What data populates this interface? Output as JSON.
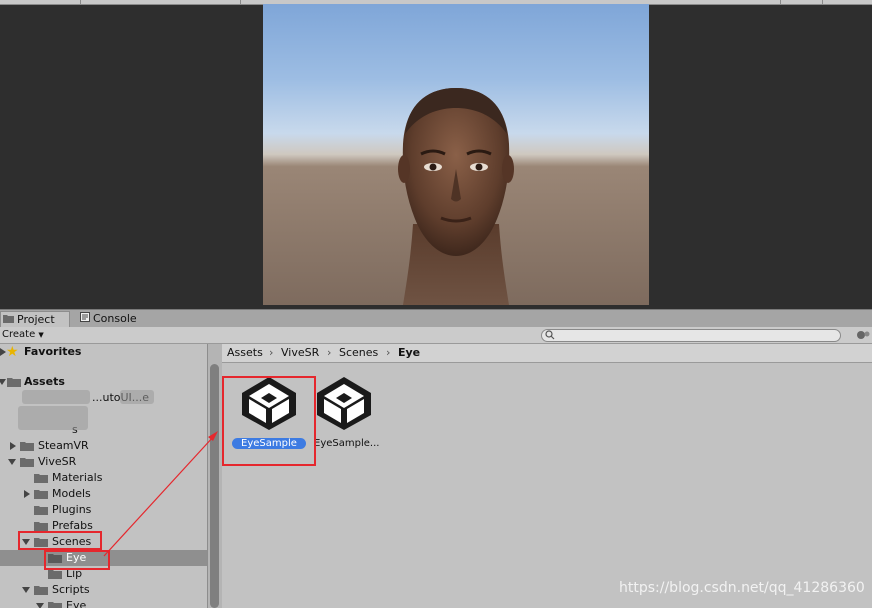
{
  "tabs": [
    {
      "label": "Project",
      "icon": "folder-icon",
      "active": true
    },
    {
      "label": "Console",
      "icon": "console-icon",
      "active": false
    }
  ],
  "toolbar": {
    "create_label": "Create",
    "filter_icon": "filter-icon"
  },
  "tree": {
    "favorites_label": "Favorites",
    "assets_label": "Assets",
    "items": [
      {
        "label": "...utoUI...e"
      },
      {
        "label": "s"
      },
      {
        "label": "SteamVR"
      },
      {
        "label": "ViveSR"
      },
      {
        "label": "Materials"
      },
      {
        "label": "Models"
      },
      {
        "label": "Plugins"
      },
      {
        "label": "Prefabs"
      },
      {
        "label": "Scenes"
      },
      {
        "label": "Eye"
      },
      {
        "label": "Lip"
      },
      {
        "label": "Scripts"
      },
      {
        "label": "Eye"
      }
    ]
  },
  "breadcrumb": [
    "Assets",
    "ViveSR",
    "Scenes",
    "Eye"
  ],
  "assets": [
    {
      "label": "EyeSample",
      "selected": true
    },
    {
      "label": "EyeSample..."
    }
  ],
  "watermark": "https://blog.csdn.net/qq_41286360",
  "colors": {
    "selection": "#3d7be2",
    "annotation_red": "#e5272d"
  }
}
